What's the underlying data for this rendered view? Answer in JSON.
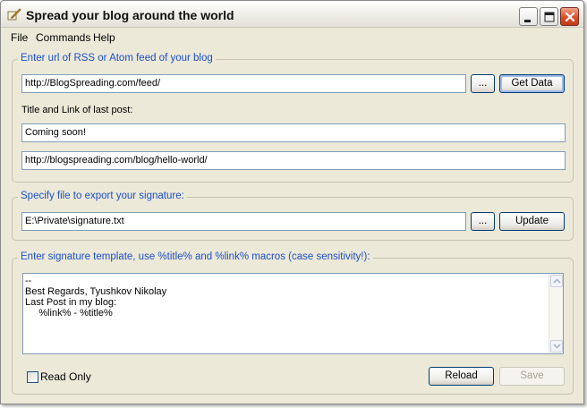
{
  "window": {
    "title": "Spread your blog around the world"
  },
  "menu": {
    "file": "File",
    "commands": "Commands",
    "help": "Help"
  },
  "rss_group": {
    "legend": "Enter url of RSS or Atom feed of your blog",
    "feed_url": "http://BlogSpreading.com/feed/",
    "browse_label": "...",
    "get_data_label": "Get Data",
    "last_post_label": "Title and Link of last post:",
    "last_post_title": "Coming soon!",
    "last_post_link": "http://blogspreading.com/blog/hello-world/"
  },
  "export_group": {
    "legend": "Specify file to export your signature:",
    "file_path": "E:\\Private\\signature.txt",
    "browse_label": "...",
    "update_label": "Update"
  },
  "template_group": {
    "legend": "Enter signature template, use %title%  and %link% macros (case sensitivity!):",
    "template_text": "--\nBest Regards, Tyushkov Nikolay\nLast Post in my blog:\n     %link% - %title%",
    "read_only_label": "Read Only",
    "read_only_checked": false,
    "reload_label": "Reload",
    "save_label": "Save"
  },
  "icons": {
    "app": "quill-pen-icon",
    "minimize": "minimize-icon",
    "maximize": "maximize-icon",
    "close": "close-icon",
    "scroll_up": "chevron-up-icon",
    "scroll_down": "chevron-down-icon"
  },
  "colors": {
    "window_bg": "#ECE9D8",
    "legend_text": "#1B4FC4",
    "close_button": "#D6502C",
    "input_border": "#7F9DB9"
  }
}
